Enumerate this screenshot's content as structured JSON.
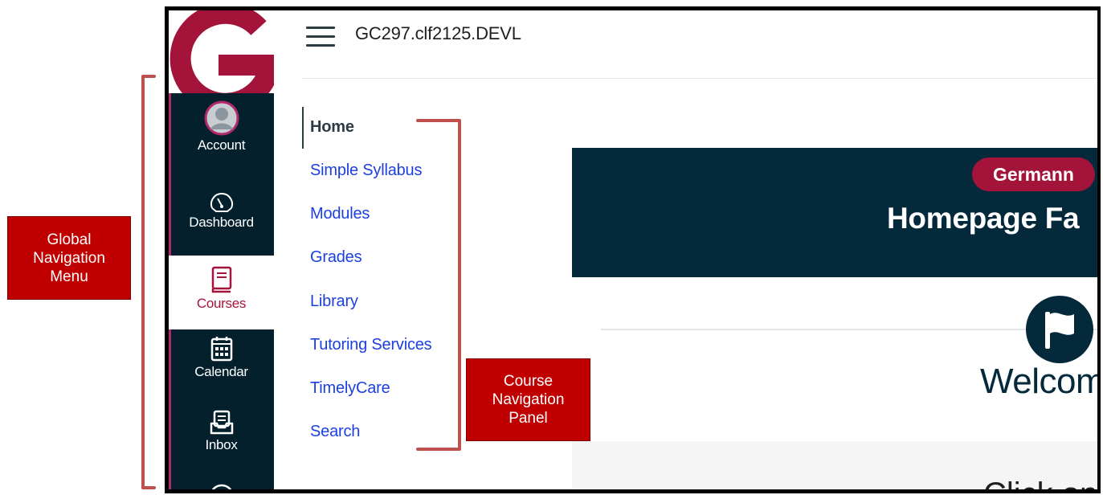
{
  "course_code": "GC297.clf2125.DEVL",
  "global_nav": {
    "account": "Account",
    "dashboard": "Dashboard",
    "courses": "Courses",
    "calendar": "Calendar",
    "inbox": "Inbox"
  },
  "course_nav": {
    "items": [
      "Home",
      "Simple Syllabus",
      "Modules",
      "Grades",
      "Library",
      "Tutoring Services",
      "TimelyCare",
      "Search"
    ],
    "active": "Home"
  },
  "banner": {
    "pill": "Germann",
    "title": "Homepage Fa"
  },
  "content": {
    "welcome": "Welcom",
    "cta": "Click on an Icon or Bu"
  },
  "annotations": {
    "global": "Global\nNavigation\nMenu",
    "course": "Course\nNavigation\nPanel"
  },
  "colors": {
    "nav_bg": "#03202c",
    "brand_red": "#a4143a",
    "link_blue": "#1c3fe0",
    "banner_bg": "#03293b",
    "callout_red": "#c00000",
    "bracket_red": "#c0504d"
  },
  "icons": [
    "hamburger-icon",
    "account-avatar-icon",
    "dashboard-gauge-icon",
    "courses-book-icon",
    "calendar-icon",
    "inbox-icon",
    "help-icon",
    "flag-icon"
  ]
}
